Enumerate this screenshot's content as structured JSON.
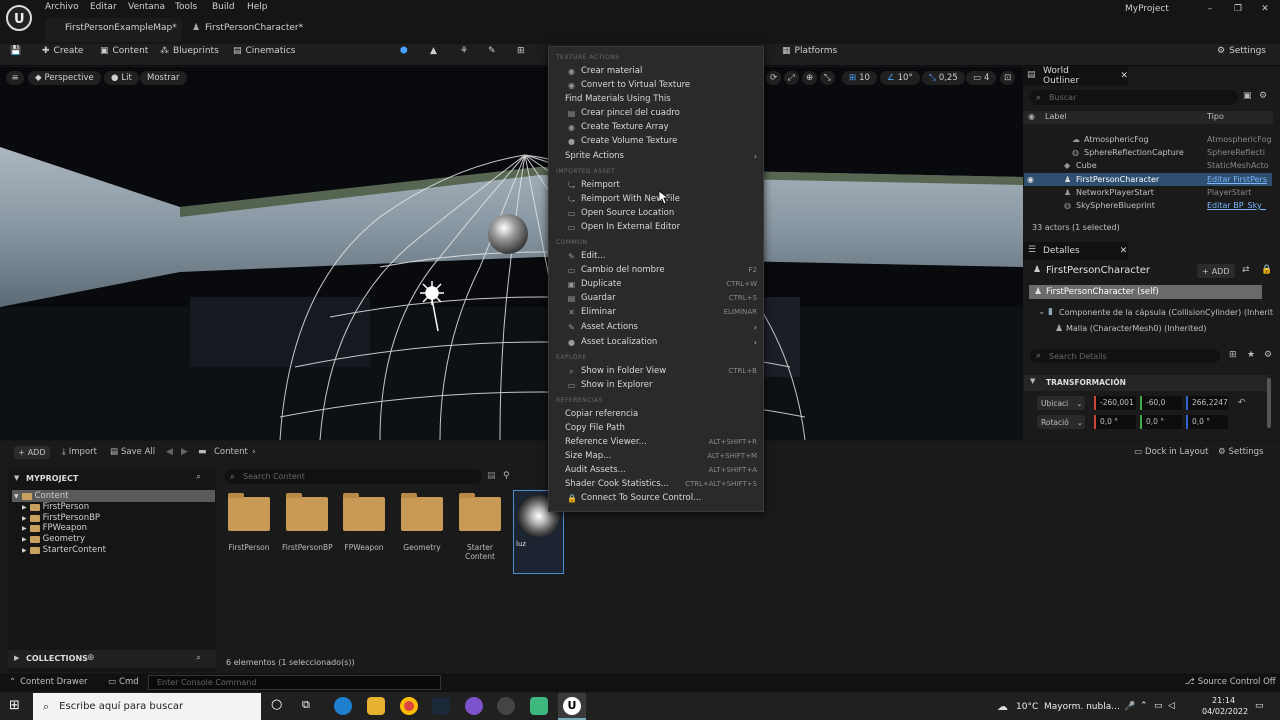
{
  "menubar": {
    "items": [
      "Archivo",
      "Editar",
      "Ventana",
      "Tools",
      "Build",
      "Help"
    ]
  },
  "tabs": {
    "map": "FirstPersonExampleMap*",
    "character": "FirstPersonCharacter*"
  },
  "project_name": "MyProject",
  "toolbar": {
    "create": "Create",
    "content": "Content",
    "blueprints": "Blueprints",
    "cinematics": "Cinematics",
    "platforms": "Platforms",
    "settings": "Settings"
  },
  "viewport": {
    "perspective": "Perspective",
    "lit": "Lit",
    "show": "Mostrar",
    "grid_size": "10",
    "rot_snap": "10°",
    "scale_snap": "0,25",
    "camera_speed": "4"
  },
  "outliner": {
    "title": "World Outliner",
    "search_placeholder": "Buscar",
    "col_label": "Label",
    "col_type": "Tipo",
    "rows": [
      {
        "label": "AtmosphericFog",
        "type": "AtmosphericFog"
      },
      {
        "label": "SphereReflectionCapture",
        "type": "SphereReflecti"
      },
      {
        "label": "Cube",
        "type": "StaticMeshActo"
      },
      {
        "label": "FirstPersonCharacter",
        "type": "Editar FirstPers"
      },
      {
        "label": "NetworkPlayerStart",
        "type": "PlayerStart"
      },
      {
        "label": "SkySphereBlueprint",
        "type": "Editar BP_Sky_"
      }
    ],
    "count": "33 actors (1 selected)"
  },
  "details": {
    "title": "Detalles",
    "object": "FirstPersonCharacter",
    "add": "ADD",
    "self": "FirstPersonCharacter (self)",
    "component1": "Componente de la cápsula (CollisionCylinder) (Inherit",
    "component2": "Malla (CharacterMesh0) (Inherited)",
    "search_placeholder": "Search Details",
    "section": "TRANSFORMACIÓN",
    "location_label": "Ubicaci",
    "location": [
      "-260,001",
      "-60,0",
      "266,2247"
    ],
    "rotation_label": "Rotació",
    "rotation": [
      "0,0 °",
      "0,0 °",
      "0,0 °"
    ]
  },
  "context_menu": {
    "sections": [
      "TEXTURE ACTIONS",
      "IMPORTED ASSET",
      "COMMON",
      "EXPLORE",
      "REFERENCIAS"
    ],
    "texture_actions": [
      {
        "label": "Crear material",
        "icon": "material-icon"
      },
      {
        "label": "Convert to Virtual Texture",
        "icon": "texture-icon"
      },
      {
        "label": "Find Materials Using This",
        "icon": ""
      },
      {
        "label": "Crear pincel del cuadro",
        "icon": "brush-icon"
      },
      {
        "label": "Create Texture Array",
        "icon": "array-icon"
      },
      {
        "label": "Create Volume Texture",
        "icon": "volume-icon"
      },
      {
        "label": "Sprite Actions",
        "icon": "",
        "submenu": true
      }
    ],
    "imported_asset": [
      {
        "label": "Reimport",
        "icon": "reimport-icon"
      },
      {
        "label": "Reimport With New File",
        "icon": "reimport-icon"
      },
      {
        "label": "Open Source Location",
        "icon": "folder-icon"
      },
      {
        "label": "Open In External Editor",
        "icon": "external-icon"
      }
    ],
    "common": [
      {
        "label": "Edit...",
        "icon": "edit-icon",
        "shortcut": ""
      },
      {
        "label": "Cambio del nombre",
        "icon": "rename-icon",
        "shortcut": "F2"
      },
      {
        "label": "Duplicate",
        "icon": "duplicate-icon",
        "shortcut": "CTRL+W"
      },
      {
        "label": "Guardar",
        "icon": "save-icon",
        "shortcut": "CTRL+S"
      },
      {
        "label": "Eliminar",
        "icon": "delete-icon",
        "shortcut": "ELIMINAR"
      },
      {
        "label": "Asset Actions",
        "icon": "actions-icon",
        "submenu": true
      },
      {
        "label": "Asset Localization",
        "icon": "globe-icon",
        "submenu": true
      }
    ],
    "explore": [
      {
        "label": "Show in Folder View",
        "icon": "search-icon",
        "shortcut": "CTRL+B"
      },
      {
        "label": "Show in Explorer",
        "icon": "folder-icon",
        "shortcut": ""
      }
    ],
    "references": [
      {
        "label": "Copiar referencia",
        "shortcut": ""
      },
      {
        "label": "Copy File Path",
        "shortcut": ""
      },
      {
        "label": "Reference Viewer...",
        "shortcut": "ALT+SHIFT+R"
      },
      {
        "label": "Size Map...",
        "shortcut": "ALT+SHIFT+M"
      },
      {
        "label": "Audit Assets...",
        "shortcut": "ALT+SHIFT+A"
      },
      {
        "label": "Shader Cook Statistics...",
        "shortcut": "CTRL+ALT+SHIFT+S"
      },
      {
        "label": "Connect To Source Control...",
        "shortcut": "",
        "icon": "lock-icon"
      }
    ]
  },
  "content_browser": {
    "add": "ADD",
    "import": "Import",
    "save_all": "Save All",
    "path": "Content",
    "dock": "Dock in Layout",
    "settings": "Settings",
    "project": "MYPROJECT",
    "tree": [
      "Content",
      "FirstPerson",
      "FirstPersonBP",
      "FPWeapon",
      "Geometry",
      "StarterContent"
    ],
    "search_placeholder": "Search Content",
    "assets": [
      "FirstPerson",
      "FirstPersonBP",
      "FPWeapon",
      "Geometry",
      "Starter Content",
      "luz"
    ],
    "collections": "COLLECTIONS",
    "status": "6 elementos (1 seleccionado(s))"
  },
  "statusbar": {
    "drawer": "Content Drawer",
    "cmd": "Cmd",
    "console_placeholder": "Enter Console Command",
    "source_control": "Source Control Off"
  },
  "taskbar": {
    "search": "Escribe aquí para buscar",
    "weather": "10°C  Mayorm. nubla...",
    "time": "21:14",
    "date": "04/02/2022"
  }
}
